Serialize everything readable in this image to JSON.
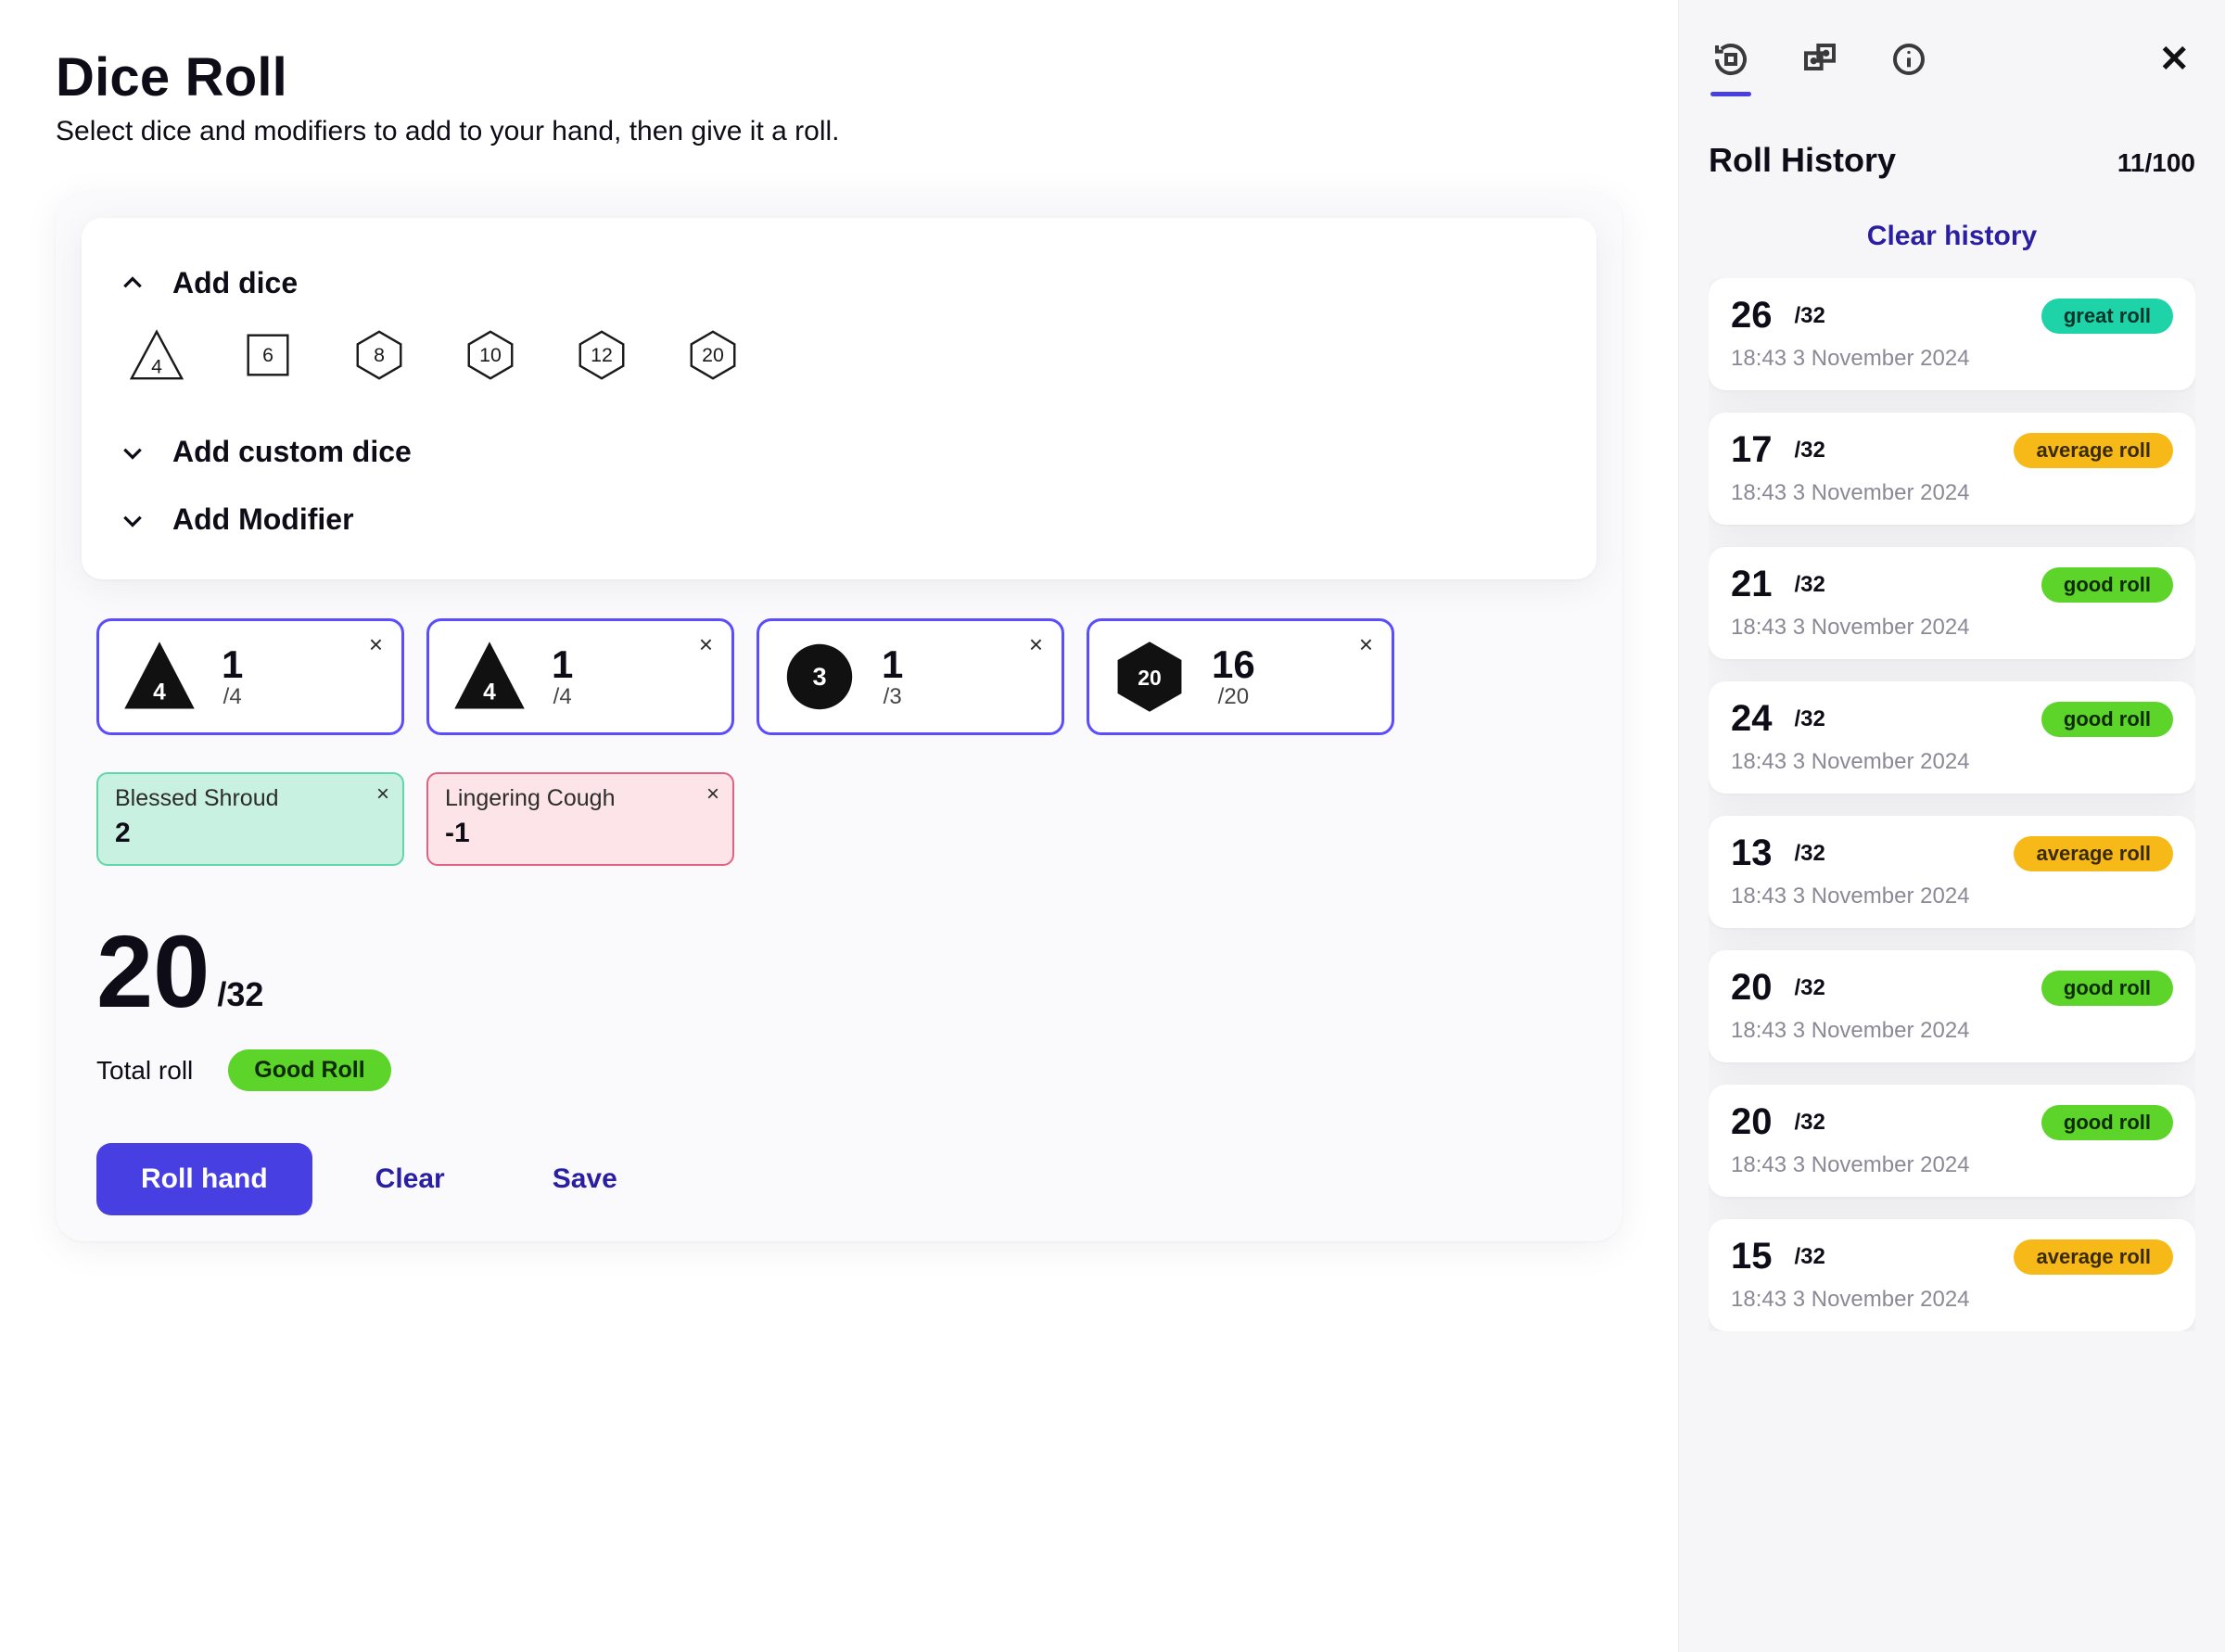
{
  "header": {
    "title": "Dice Roll",
    "subtitle": "Select dice and modifiers to add to your hand, then give it a roll."
  },
  "accordion": {
    "add_dice": "Add dice",
    "add_custom": "Add custom dice",
    "add_modifier": "Add Modifier"
  },
  "dice_options": {
    "d4": "4",
    "d6": "6",
    "d8": "8",
    "d10": "10",
    "d12": "12",
    "d20": "20"
  },
  "hand": [
    {
      "face": "4",
      "value": "1",
      "max": "/4",
      "shape": "d4"
    },
    {
      "face": "4",
      "value": "1",
      "max": "/4",
      "shape": "d4"
    },
    {
      "face": "3",
      "value": "1",
      "max": "/3",
      "shape": "circle"
    },
    {
      "face": "20",
      "value": "16",
      "max": "/20",
      "shape": "d20"
    }
  ],
  "modifiers": [
    {
      "name": "Blessed Shroud",
      "value": "2",
      "sign": "pos"
    },
    {
      "name": "Lingering Cough",
      "value": "-1",
      "sign": "neg"
    }
  ],
  "total": {
    "value": "20",
    "max": "/32",
    "caption": "Total roll",
    "tag": "Good Roll"
  },
  "actions": {
    "roll": "Roll hand",
    "clear": "Clear",
    "save": "Save"
  },
  "sidebar": {
    "title": "Roll History",
    "count": "11/100",
    "clear": "Clear history",
    "history": [
      {
        "value": "26",
        "max": "/32",
        "tag": "great roll",
        "tagClass": "great",
        "time": "18:43 3 November 2024"
      },
      {
        "value": "17",
        "max": "/32",
        "tag": "average roll",
        "tagClass": "avg",
        "time": "18:43 3 November 2024"
      },
      {
        "value": "21",
        "max": "/32",
        "tag": "good roll",
        "tagClass": "good",
        "time": "18:43 3 November 2024"
      },
      {
        "value": "24",
        "max": "/32",
        "tag": "good roll",
        "tagClass": "good",
        "time": "18:43 3 November 2024"
      },
      {
        "value": "13",
        "max": "/32",
        "tag": "average roll",
        "tagClass": "avg",
        "time": "18:43 3 November 2024"
      },
      {
        "value": "20",
        "max": "/32",
        "tag": "good roll",
        "tagClass": "good",
        "time": "18:43 3 November 2024"
      },
      {
        "value": "20",
        "max": "/32",
        "tag": "good roll",
        "tagClass": "good",
        "time": "18:43 3 November 2024"
      },
      {
        "value": "15",
        "max": "/32",
        "tag": "average roll",
        "tagClass": "avg",
        "time": "18:43 3 November 2024"
      }
    ]
  }
}
